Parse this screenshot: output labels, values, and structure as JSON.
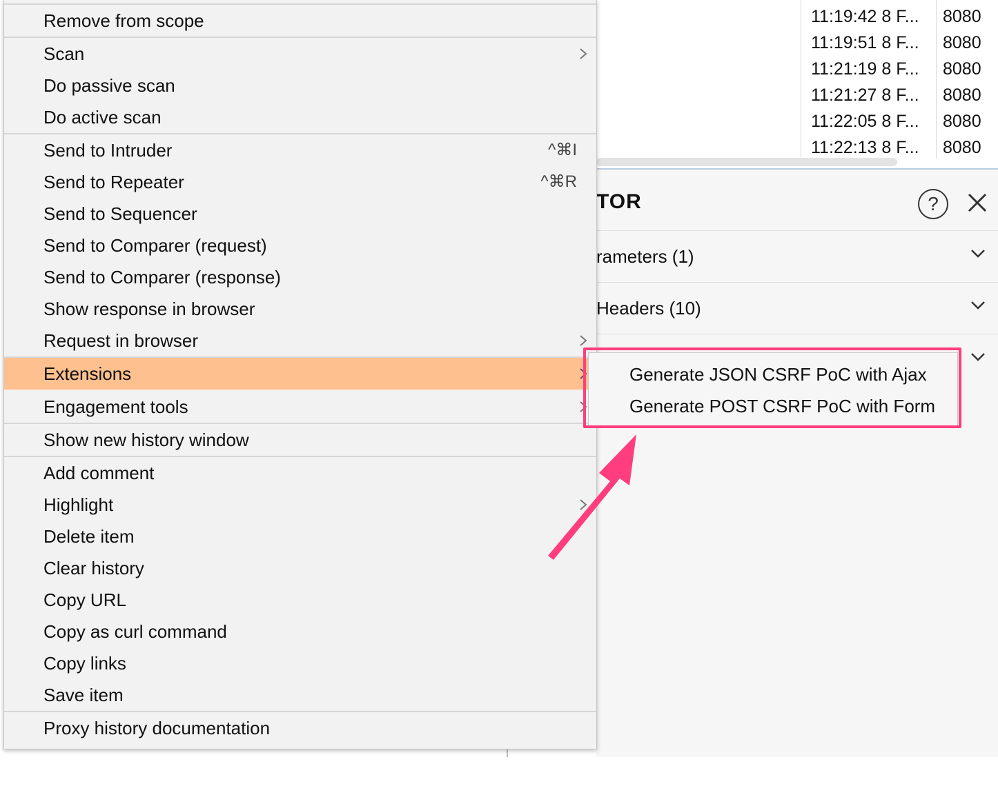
{
  "history": {
    "rows": [
      {
        "time": "11:19:42 8 F...",
        "port": "8080"
      },
      {
        "time": "11:19:51 8 F...",
        "port": "8080"
      },
      {
        "time": "11:21:19 8 F...",
        "port": "8080"
      },
      {
        "time": "11:21:27 8 F...",
        "port": "8080"
      },
      {
        "time": "11:22:05 8 F...",
        "port": "8080"
      },
      {
        "time": "11:22:13 8 F...",
        "port": "8080"
      }
    ]
  },
  "inspector": {
    "title": "TOR",
    "help_glyph": "?",
    "sections": [
      {
        "label": "rameters (1)"
      },
      {
        "label": "Headers (10)"
      }
    ]
  },
  "context_menu": {
    "items": [
      {
        "label": "Remove from scope"
      },
      {
        "label": "Scan"
      },
      {
        "label": "Do passive scan"
      },
      {
        "label": "Do active scan"
      },
      {
        "label": "Send to Intruder",
        "shortcut": "^⌘I"
      },
      {
        "label": "Send to Repeater",
        "shortcut": "^⌘R"
      },
      {
        "label": "Send to Sequencer"
      },
      {
        "label": "Send to Comparer (request)"
      },
      {
        "label": "Send to Comparer (response)"
      },
      {
        "label": "Show response in browser"
      },
      {
        "label": "Request in browser"
      },
      {
        "label": "Extensions"
      },
      {
        "label": "Engagement tools"
      },
      {
        "label": "Show new history window"
      },
      {
        "label": "Add comment"
      },
      {
        "label": "Highlight"
      },
      {
        "label": "Delete item"
      },
      {
        "label": "Clear history"
      },
      {
        "label": "Copy URL"
      },
      {
        "label": "Copy as curl command"
      },
      {
        "label": "Copy links"
      },
      {
        "label": "Save item"
      },
      {
        "label": "Proxy history documentation"
      }
    ],
    "active_item": "Extensions"
  },
  "submenu": {
    "items": [
      {
        "label": "Generate JSON CSRF PoC with Ajax"
      },
      {
        "label": "Generate POST CSRF PoC with Form"
      }
    ]
  },
  "colors": {
    "active_item_bg": "#fdc08e",
    "annotation": "#ff3d7f"
  },
  "icons": [
    "chevron-right-icon",
    "chevron-down-icon",
    "help-icon",
    "close-icon",
    "annotation-arrow-icon"
  ]
}
